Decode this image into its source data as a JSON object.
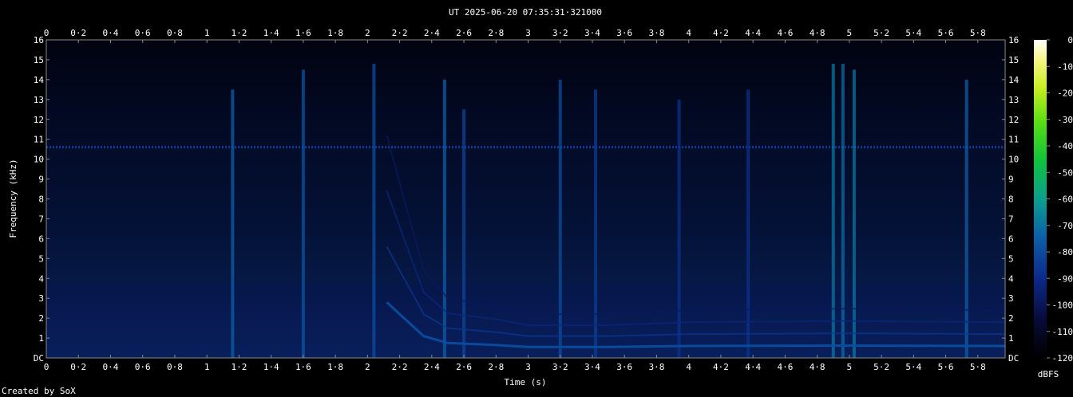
{
  "title": "UT 2025-06-20 07:35:31·321000",
  "credit": "Created by SoX",
  "colors": {
    "background": "#000000",
    "axis": "#8a8a8a",
    "text": "#ffffff"
  },
  "chart_data": {
    "type": "heatmap",
    "xlabel": "Time (s)",
    "ylabel": "Frequency (kHz)",
    "xlim": [
      0,
      5.97
    ],
    "ylim": [
      0,
      16
    ],
    "x_ticks": [
      "0",
      "0·2",
      "0·4",
      "0·6",
      "0·8",
      "1",
      "1·2",
      "1·4",
      "1·6",
      "1·8",
      "2",
      "2·2",
      "2·4",
      "2·6",
      "2·8",
      "3",
      "3·2",
      "3·4",
      "3·6",
      "3·8",
      "4",
      "4·2",
      "4·4",
      "4·6",
      "4·8",
      "5",
      "5·2",
      "5·4",
      "5·6",
      "5·8"
    ],
    "y_ticks": [
      "DC",
      "1",
      "2",
      "3",
      "4",
      "5",
      "6",
      "7",
      "8",
      "9",
      "10",
      "11",
      "12",
      "13",
      "14",
      "15",
      "16"
    ],
    "colorbar": {
      "label": "dBFS",
      "ticks": [
        "0",
        "-10",
        "-20",
        "-30",
        "-40",
        "-50",
        "-60",
        "-70",
        "-80",
        "-90",
        "-100",
        "-110",
        "-120"
      ],
      "range": [
        -120,
        0
      ]
    },
    "background_level_dbfs": -100,
    "constant_tone": {
      "freq_khz": 10.6,
      "level_dbfs": -85
    },
    "broadband_transients": [
      {
        "t": 1.16,
        "top_khz": 13.5,
        "level_dbfs": -75
      },
      {
        "t": 1.6,
        "top_khz": 14.5,
        "level_dbfs": -78
      },
      {
        "t": 2.04,
        "top_khz": 14.8,
        "level_dbfs": -80
      },
      {
        "t": 2.48,
        "top_khz": 14,
        "level_dbfs": -75
      },
      {
        "t": 2.6,
        "top_khz": 12.5,
        "level_dbfs": -82
      },
      {
        "t": 3.2,
        "top_khz": 14,
        "level_dbfs": -80
      },
      {
        "t": 3.42,
        "top_khz": 13.5,
        "level_dbfs": -85
      },
      {
        "t": 3.94,
        "top_khz": 13,
        "level_dbfs": -88
      },
      {
        "t": 4.37,
        "top_khz": 13.5,
        "level_dbfs": -88
      },
      {
        "t": 4.9,
        "top_khz": 14.8,
        "level_dbfs": -70
      },
      {
        "t": 4.96,
        "top_khz": 14.8,
        "level_dbfs": -72
      },
      {
        "t": 5.03,
        "top_khz": 14.5,
        "level_dbfs": -70
      },
      {
        "t": 5.73,
        "top_khz": 14,
        "level_dbfs": -75
      }
    ],
    "harmonic_series": {
      "start_t": 2.12,
      "end_t": 5.97,
      "fundamental_khz": [
        [
          2.12,
          2.8
        ],
        [
          2.2,
          2.2
        ],
        [
          2.35,
          1.1
        ],
        [
          2.5,
          0.75
        ],
        [
          2.8,
          0.65
        ],
        [
          3.0,
          0.55
        ],
        [
          3.5,
          0.55
        ],
        [
          4.0,
          0.6
        ],
        [
          5.0,
          0.62
        ],
        [
          5.97,
          0.6
        ]
      ],
      "harmonics": 4,
      "level_dbfs": -80
    }
  }
}
